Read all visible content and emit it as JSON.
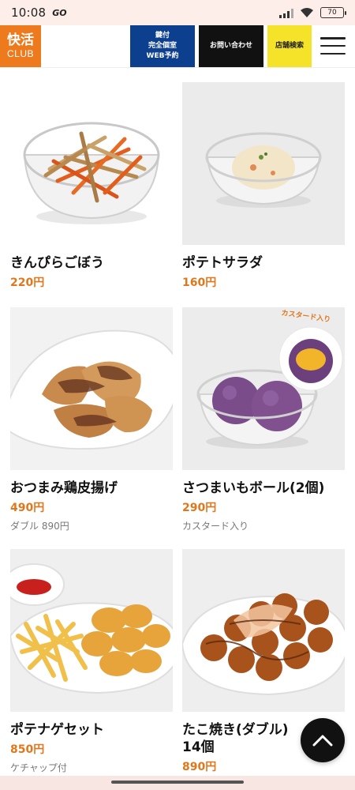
{
  "status_bar": {
    "time": "10:08",
    "app_glyph": "GO",
    "battery": "70"
  },
  "header": {
    "logo_top": "快活",
    "logo_bottom": "CLUB",
    "reserve_line1": "鍵付",
    "reserve_line2": "完全個室",
    "reserve_line3": "WEB予約",
    "contact_label": "お問い合わせ",
    "store_label": "店舗検索"
  },
  "items": [
    {
      "name": "きんぴらごぼう",
      "price": "220円",
      "note": "",
      "image": "kinpira-bowl"
    },
    {
      "name": "ポテトサラダ",
      "price": "160円",
      "note": "",
      "image": "potato-salad-bowl"
    },
    {
      "name": "おつまみ鶏皮揚げ",
      "price": "490円",
      "note": "ダブル 890円",
      "image": "fried-chicken-skin-plate"
    },
    {
      "name": "さつまいもボール(2個)",
      "price": "290円",
      "note": "カスタード入り",
      "image": "sweet-potato-balls-bowl",
      "badge": "カスタード入り"
    },
    {
      "name": "ポテナゲセット",
      "price": "850円",
      "note": "ケチャップ付",
      "image": "fries-nuggets-plate"
    },
    {
      "name_line1": "たこ焼き(ダブル)",
      "name_line2": "14個",
      "price": "890円",
      "note": "",
      "image": "takoyaki-plate"
    }
  ],
  "colors": {
    "brand_orange": "#ee7a1e",
    "reserve_blue": "#0d3f8f",
    "store_yellow": "#f5e32a",
    "price_orange": "#e0771d"
  }
}
